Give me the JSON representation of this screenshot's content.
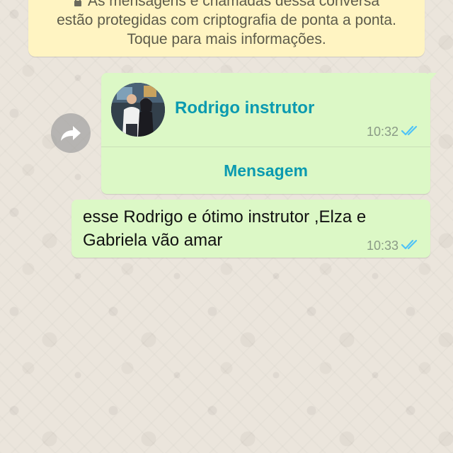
{
  "encryption_notice": {
    "line1": "As mensagens e chamadas dessa conversa",
    "line2": "estão protegidas com criptografia de ponta a ponta.",
    "line3": "Toque para mais informações."
  },
  "contact_message": {
    "name": "Rodrigo instrutor",
    "time": "10:32",
    "action_label": "Mensagem",
    "status": "read"
  },
  "text_message": {
    "text": "esse Rodrigo e ótimo instrutor ,Elza e Gabriela vão amar",
    "time": "10:33",
    "status": "read"
  },
  "icons": {
    "forward": "forward-icon",
    "lock": "lock-icon",
    "read_receipt": "double-check-icon"
  },
  "colors": {
    "chat_background": "#ece5dd",
    "notice_background": "#fff4c2",
    "outgoing_bubble": "#dcf8c6",
    "contact_accent": "#0b9ab0",
    "read_ticks": "#4fc3f7"
  }
}
